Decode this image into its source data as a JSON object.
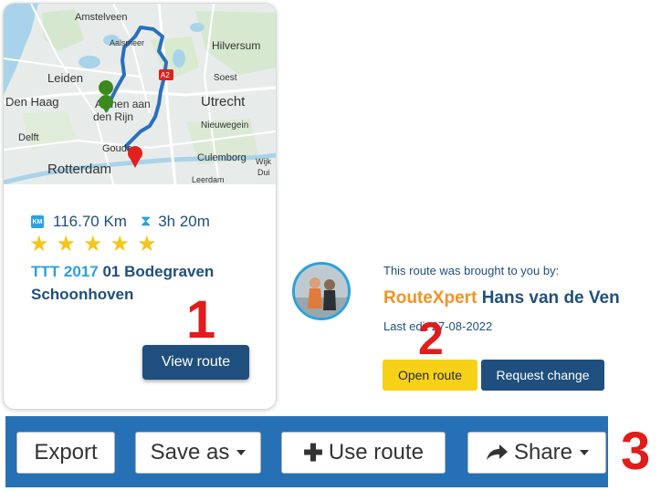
{
  "map_card": {
    "map_labels": [
      "Amstelveen",
      "Aalsmeer",
      "Hilversum",
      "Leiden",
      "Soest",
      "Den Haag",
      "Alphen aan den Rijn",
      "Utrecht",
      "Nieuwegein",
      "Delft",
      "Gouda",
      "Culemborg",
      "Rotterdam",
      "Wijk",
      "Dui",
      "Leerdam",
      "A2"
    ],
    "start_marker_color": "#3a8a1c",
    "end_marker_color": "#e0211d",
    "route_color": "#2a6fbf",
    "distance": "116.70 Km",
    "duration": "3h 20m",
    "rating_stars": 5,
    "title_series": "TTT 2017",
    "title_rest": "01 Bodegraven Schoonhoven",
    "view_button": "View route"
  },
  "author_panel": {
    "brought_by": "This route was brought to you by:",
    "brand": "RouteXpert",
    "author_name": "Hans van de Ven",
    "last_edit": "Last edit 27-08-2022",
    "open_button": "Open route",
    "request_button": "Request change"
  },
  "toolbar": {
    "export": "Export",
    "save_as": "Save as",
    "use_route": "Use route",
    "share": "Share"
  },
  "markers": {
    "one": "1",
    "two": "2",
    "three": "3"
  },
  "colors": {
    "primary": "#1f4f7e",
    "accent": "#2aa1e0",
    "toolbar_bg": "#2670b6",
    "open_btn": "#f7d117",
    "callout": "#e21b1b",
    "star": "#f5c518"
  }
}
